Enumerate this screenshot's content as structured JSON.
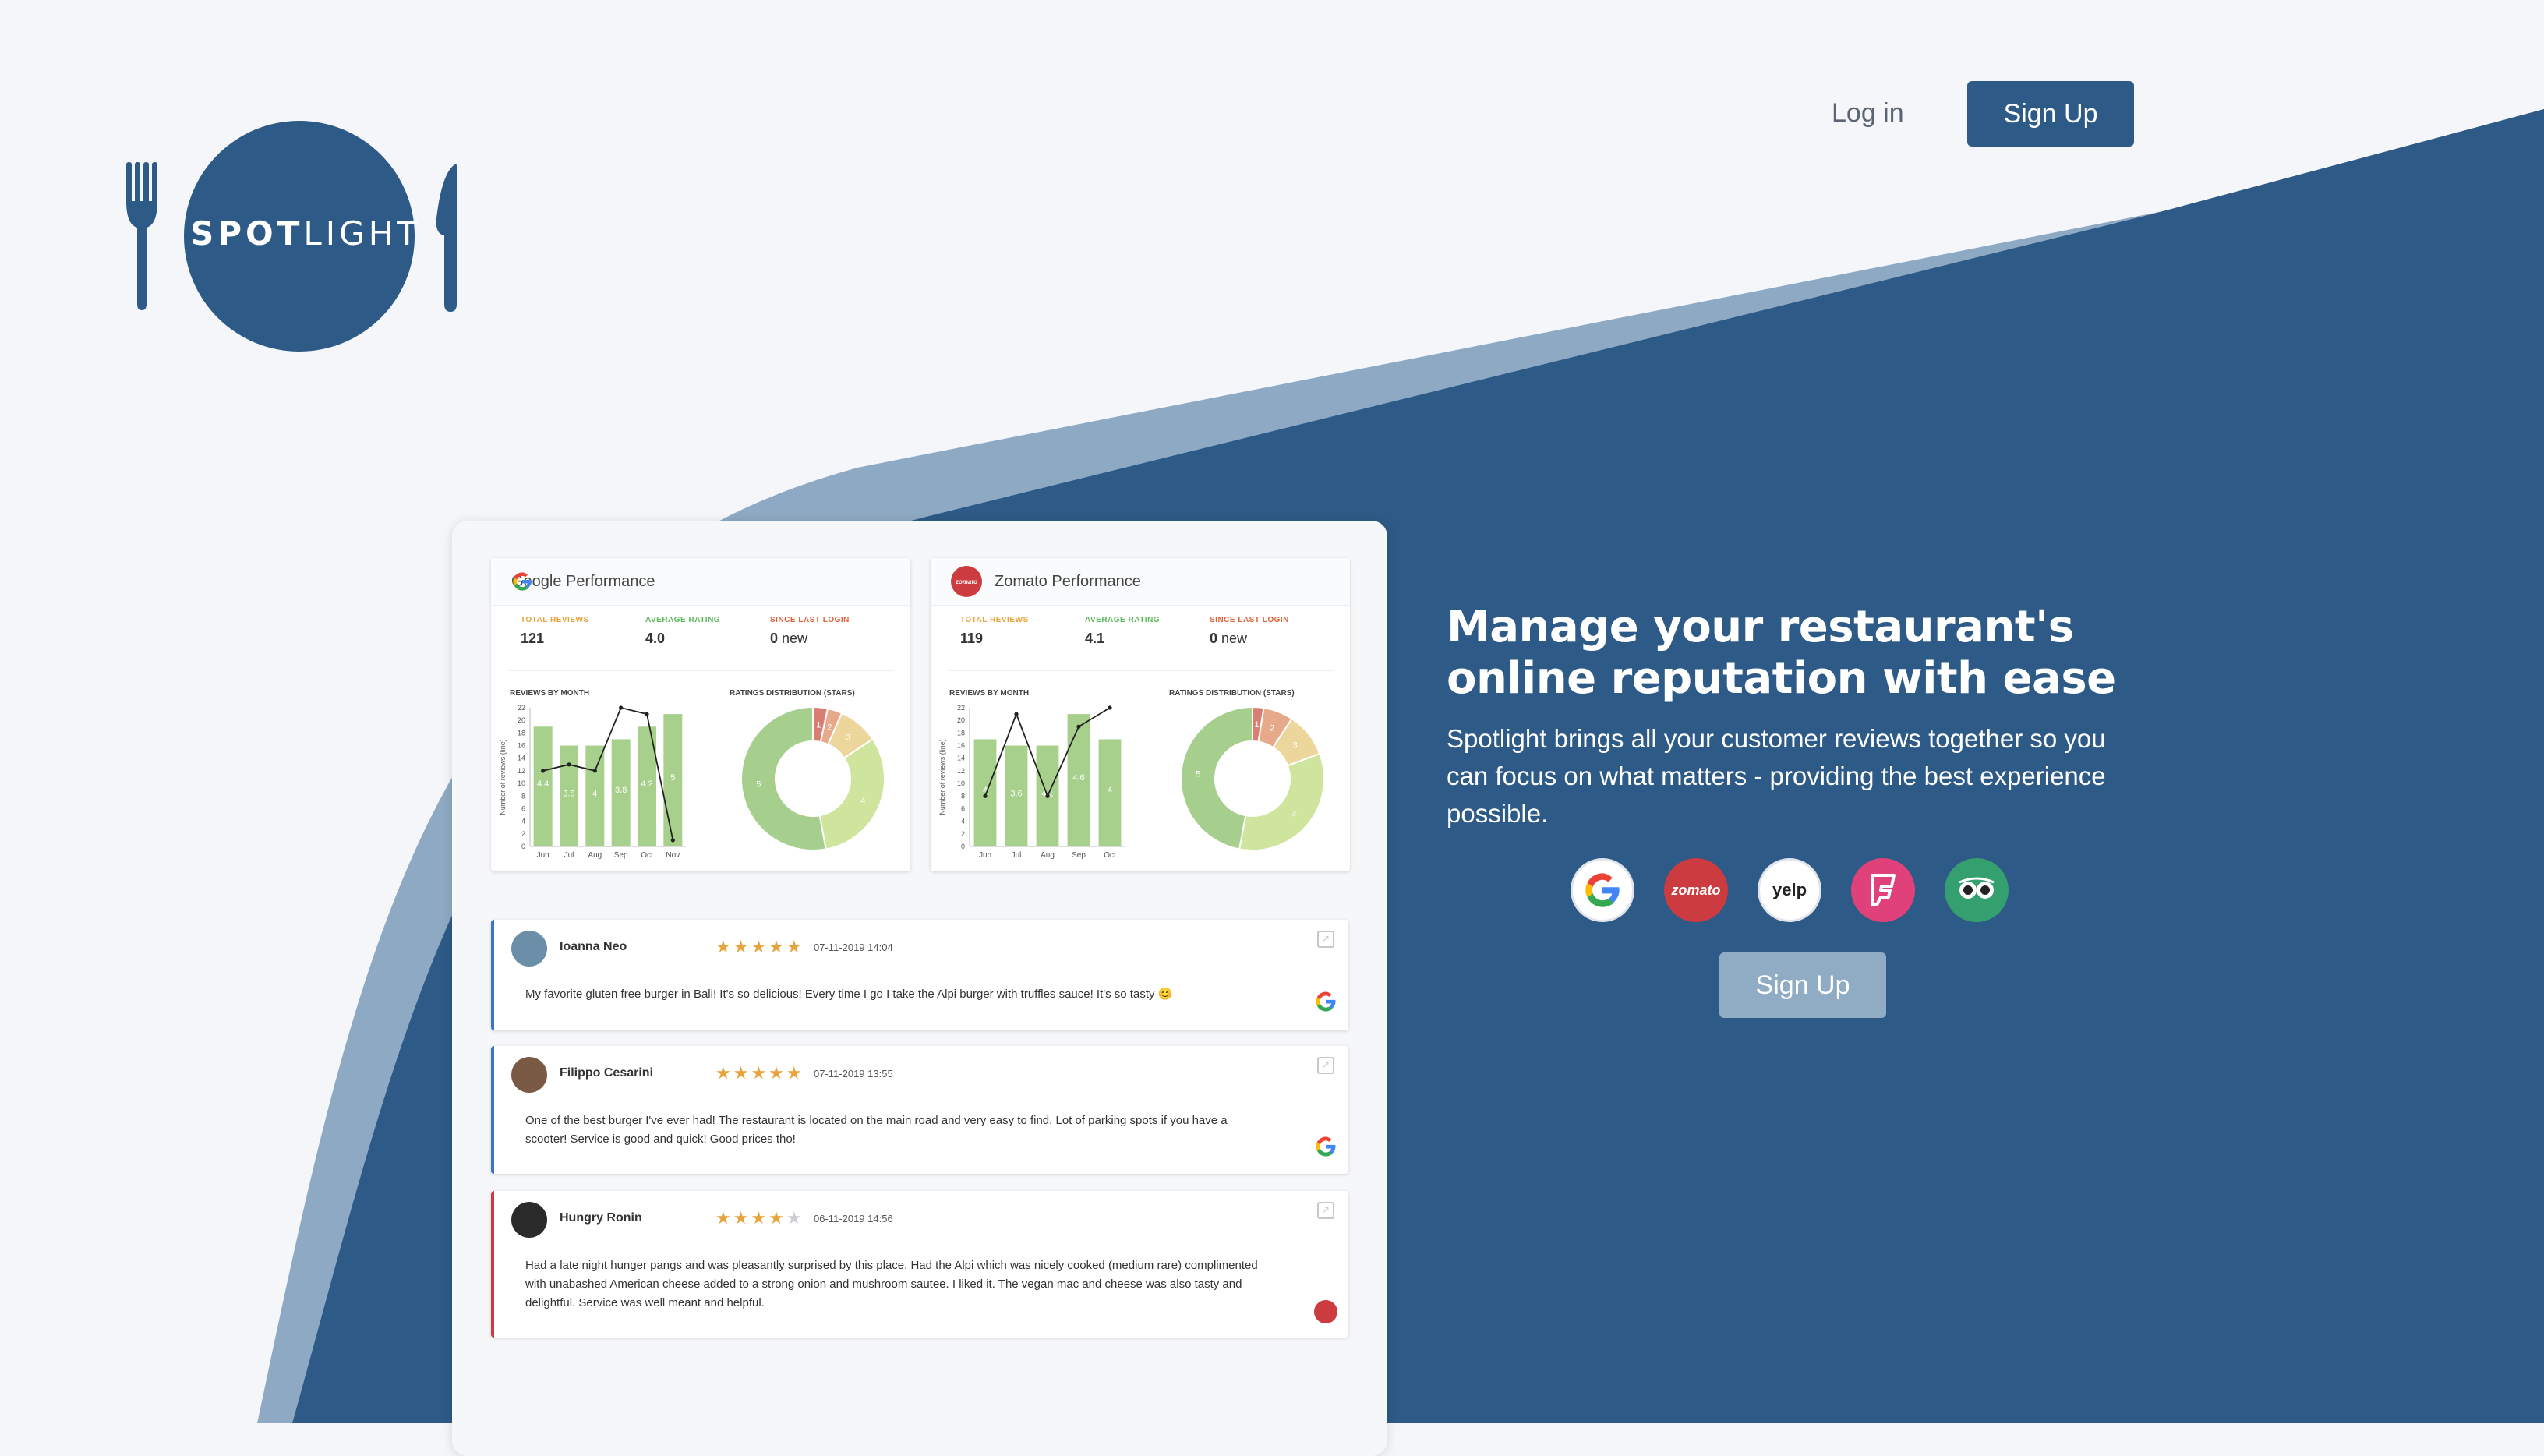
{
  "brand": {
    "logo_bold": "SPOT",
    "logo_light": "LIGHT"
  },
  "nav": {
    "login": "Log in",
    "signup": "Sign Up"
  },
  "hero": {
    "title": "Manage your restaurant's online reputation with ease",
    "subtitle": "Spotlight brings all your customer reviews together so you can focus on what matters - providing the best experience possible.",
    "signup": "Sign Up",
    "sources": [
      "google-icon",
      "zomato-icon",
      "yelp-icon",
      "foursquare-icon",
      "tripadvisor-icon"
    ],
    "source_labels": {
      "zomato": "zomato",
      "yelp": "yelp",
      "foursquare": "F"
    }
  },
  "colors": {
    "brand_navy": "#2d5a86",
    "light_band": "#8ea9c3",
    "zomato_red": "#cb3b40",
    "star": "#e8a33c",
    "bar_green": "#a8d08d",
    "total_reviews": "#e8a33c",
    "average_rating": "#5cb85c",
    "since_last_login": "#e0643a"
  },
  "dashboard": {
    "labels": {
      "total_reviews": "TOTAL REVIEWS",
      "average_rating": "AVERAGE RATING",
      "since_last_login": "SINCE LAST LOGIN",
      "reviews_by_month": "REVIEWS BY MONTH",
      "ratings_distribution": "RATINGS DISTRIBUTION (STARS)",
      "y_axis": "Number of reviews (line)",
      "new": "new"
    },
    "google": {
      "title": "Google Performance",
      "total_reviews": "121",
      "average_rating": "4.0",
      "since_last_login": "0",
      "chart_data": {
        "type": "bar",
        "categories": [
          "Jun",
          "Jul",
          "Aug",
          "Sep",
          "Oct",
          "Nov"
        ],
        "yticks": [
          0,
          2,
          4,
          6,
          8,
          10,
          12,
          14,
          16,
          18,
          20,
          22
        ],
        "ylim": [
          0,
          22
        ],
        "bar_values": [
          19,
          16,
          16,
          17,
          19,
          21
        ],
        "bar_labels": [
          "4.4",
          "3.8",
          "4",
          "3.8",
          "4.2",
          "5"
        ],
        "line_values": [
          12,
          13,
          12,
          22,
          21,
          1
        ]
      },
      "donut": {
        "values": [
          4,
          4,
          11,
          38,
          64
        ],
        "labels": [
          "1",
          "2",
          "3",
          "4",
          "5"
        ],
        "colors": [
          "#d97e73",
          "#e6a98a",
          "#ecd69c",
          "#cfe49c",
          "#a6cf8e"
        ]
      }
    },
    "zomato": {
      "title": "Zomato Performance",
      "total_reviews": "119",
      "average_rating": "4.1",
      "since_last_login": "0",
      "chart_data": {
        "type": "bar",
        "categories": [
          "Jun",
          "Jul",
          "Aug",
          "Sep",
          "Oct"
        ],
        "yticks": [
          0,
          2,
          4,
          6,
          8,
          10,
          12,
          14,
          16,
          18,
          20,
          22
        ],
        "ylim": [
          0,
          22
        ],
        "bar_values": [
          17,
          16,
          16,
          21,
          17
        ],
        "bar_labels": [
          "4",
          "3.6",
          "4.1",
          "4.6",
          "4"
        ],
        "line_values": [
          8,
          21,
          8,
          19,
          22
        ]
      },
      "donut": {
        "values": [
          3,
          8,
          12,
          40,
          56
        ],
        "labels": [
          "1",
          "2",
          "3",
          "4",
          "5"
        ],
        "colors": [
          "#d97e73",
          "#e6a98a",
          "#ecd69c",
          "#cfe49c",
          "#a6cf8e"
        ]
      }
    }
  },
  "reviews": [
    {
      "name": "Ioanna Neo",
      "stars": 5,
      "date": "07-11-2019 14:04",
      "source": "google",
      "text": "My favorite gluten free burger in Bali! It's so delicious! Every time I go I take the Alpi burger with truffles sauce! It's so tasty 😊"
    },
    {
      "name": "Filippo Cesarini",
      "stars": 5,
      "date": "07-11-2019 13:55",
      "source": "google",
      "text": "One of the best burger I've ever had! The restaurant is located on the main road and very easy to find. Lot of parking spots if you have a scooter! Service is good and quick! Good prices tho!"
    },
    {
      "name": "Hungry Ronin",
      "stars": 4,
      "date": "06-11-2019 14:56",
      "source": "zomato",
      "text": "Had a late night hunger pangs and was pleasantly surprised by this place. Had the Alpi which was nicely cooked (medium rare) complimented with unabashed American cheese added to a strong onion and mushroom sautee. I liked it. The vegan mac and cheese was also tasty and delightful. Service was well meant and helpful."
    }
  ]
}
